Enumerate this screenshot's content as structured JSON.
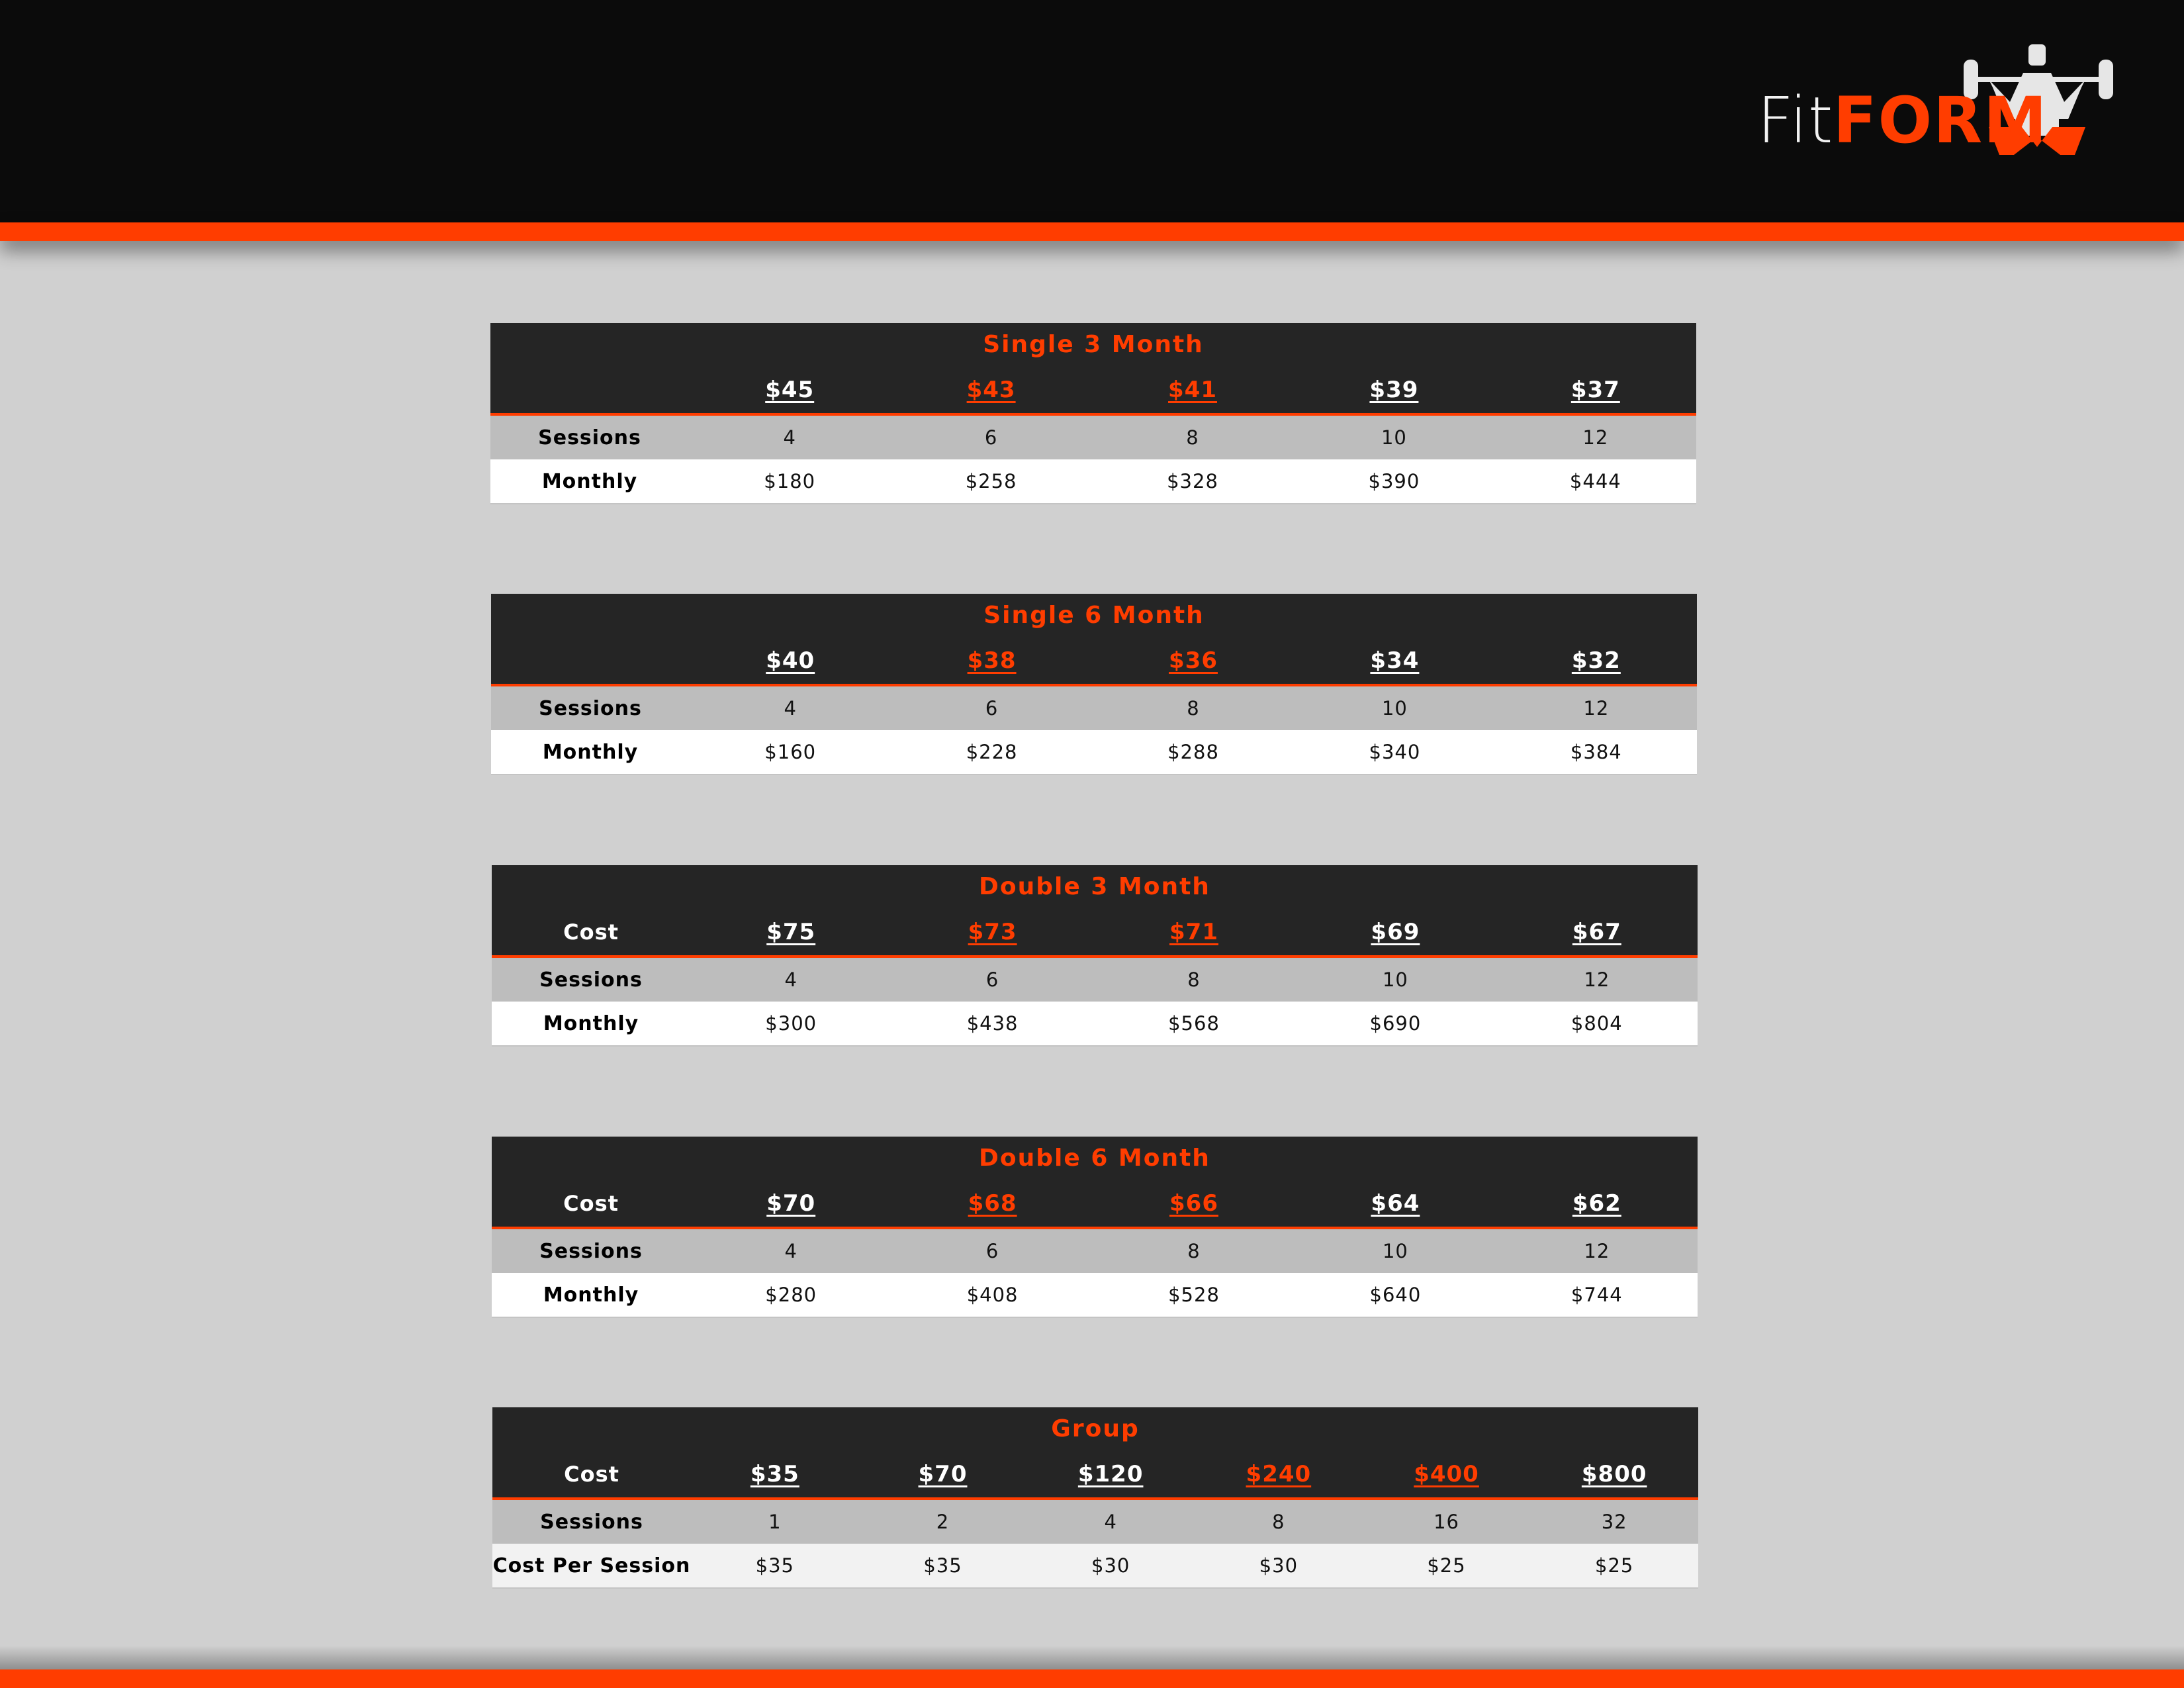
{
  "brand": {
    "fit": "Fit",
    "form": "FORM",
    "accent_color": "#ff3d00",
    "logo_icon": "weightlifter-icon"
  },
  "tables": [
    {
      "title": "Single 3 Month",
      "cost_label": "",
      "costs": [
        "$45",
        "$43",
        "$41",
        "$39",
        "$37"
      ],
      "highlighted": [
        1,
        2
      ],
      "sessions_label": "Sessions",
      "sessions": [
        "4",
        "6",
        "8",
        "10",
        "12"
      ],
      "monthly_label": "Monthly",
      "monthly": [
        "$180",
        "$258",
        "$328",
        "$390",
        "$444"
      ]
    },
    {
      "title": "Single 6 Month",
      "cost_label": "",
      "costs": [
        "$40",
        "$38",
        "$36",
        "$34",
        "$32"
      ],
      "highlighted": [
        1,
        2
      ],
      "sessions_label": "Sessions",
      "sessions": [
        "4",
        "6",
        "8",
        "10",
        "12"
      ],
      "monthly_label": "Monthly",
      "monthly": [
        "$160",
        "$228",
        "$288",
        "$340",
        "$384"
      ]
    },
    {
      "title": "Double 3 Month",
      "cost_label": "Cost",
      "costs": [
        "$75",
        "$73",
        "$71",
        "$69",
        "$67"
      ],
      "highlighted": [
        1,
        2
      ],
      "sessions_label": "Sessions",
      "sessions": [
        "4",
        "6",
        "8",
        "10",
        "12"
      ],
      "monthly_label": "Monthly",
      "monthly": [
        "$300",
        "$438",
        "$568",
        "$690",
        "$804"
      ]
    },
    {
      "title": "Double 6 Month",
      "cost_label": "Cost",
      "costs": [
        "$70",
        "$68",
        "$66",
        "$64",
        "$62"
      ],
      "highlighted": [
        1,
        2
      ],
      "sessions_label": "Sessions",
      "sessions": [
        "4",
        "6",
        "8",
        "10",
        "12"
      ],
      "monthly_label": "Monthly",
      "monthly": [
        "$280",
        "$408",
        "$528",
        "$640",
        "$744"
      ]
    },
    {
      "title": "Group",
      "cost_label": "Cost",
      "costs": [
        "$35",
        "$70",
        "$120",
        "$240",
        "$400",
        "$800"
      ],
      "highlighted": [
        3,
        4
      ],
      "sessions_label": "Sessions",
      "sessions": [
        "1",
        "2",
        "4",
        "8",
        "16",
        "32"
      ],
      "monthly_label": "Cost Per Session",
      "monthly": [
        "$35",
        "$35",
        "$30",
        "$30",
        "$25",
        "$25"
      ]
    }
  ]
}
